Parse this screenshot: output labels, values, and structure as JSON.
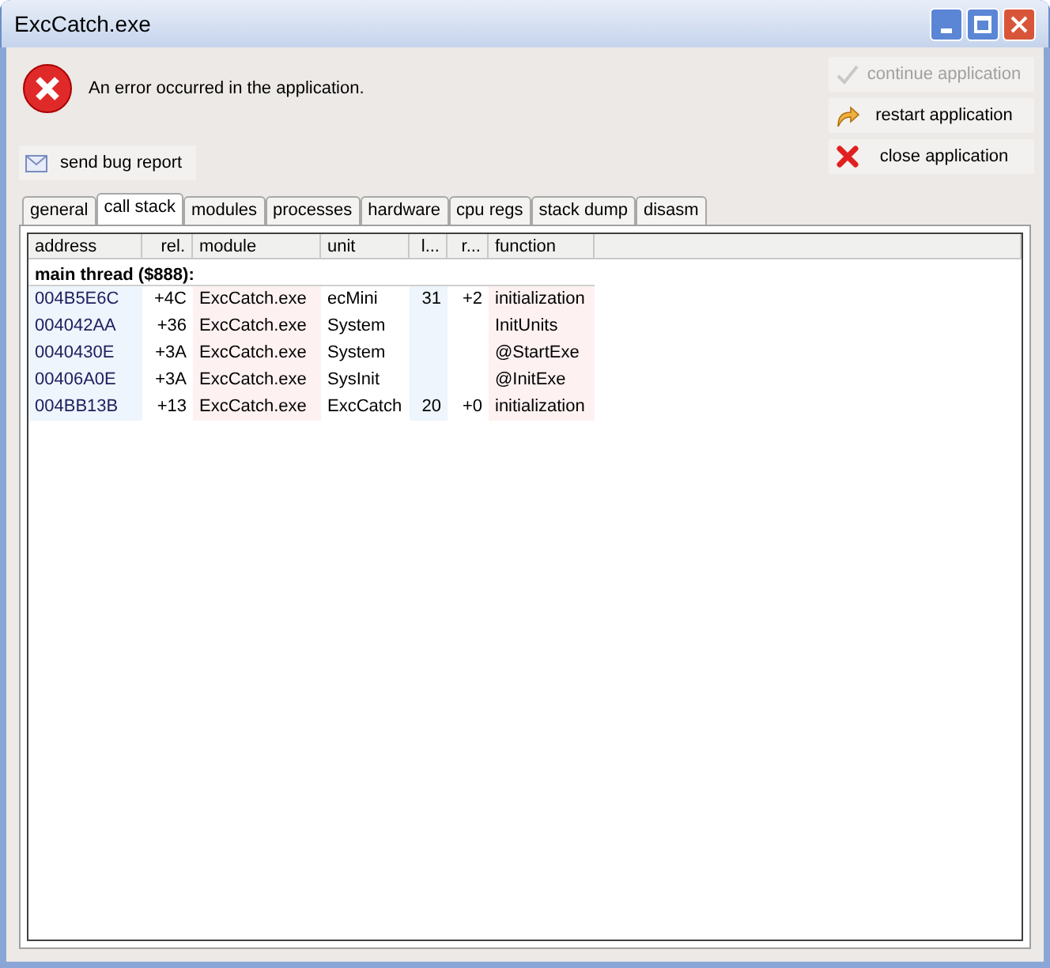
{
  "window": {
    "title": "ExcCatch.exe"
  },
  "message": "An error occurred in the application.",
  "report_button": {
    "label": "send bug report"
  },
  "actions": [
    {
      "kind": "continue",
      "label": "continue application",
      "disabled": true
    },
    {
      "kind": "restart",
      "label": "restart application",
      "disabled": false
    },
    {
      "kind": "close",
      "label": "close application",
      "disabled": false
    }
  ],
  "tabs": [
    {
      "label": "general",
      "selected": false
    },
    {
      "label": "call stack",
      "selected": true
    },
    {
      "label": "modules",
      "selected": false
    },
    {
      "label": "processes",
      "selected": false
    },
    {
      "label": "hardware",
      "selected": false
    },
    {
      "label": "cpu regs",
      "selected": false
    },
    {
      "label": "stack dump",
      "selected": false
    },
    {
      "label": "disasm",
      "selected": false
    }
  ],
  "table": {
    "columns": [
      "address",
      "rel.",
      "module",
      "unit",
      "l...",
      "r...",
      "function"
    ],
    "group": "main thread ($888):",
    "rows": [
      [
        "004B5E6C",
        "+4C",
        "ExcCatch.exe",
        "ecMini",
        "31",
        "+2",
        "initialization"
      ],
      [
        "004042AA",
        "+36",
        "ExcCatch.exe",
        "System",
        "",
        "",
        "InitUnits"
      ],
      [
        "0040430E",
        "+3A",
        "ExcCatch.exe",
        "System",
        "",
        "",
        "@StartExe"
      ],
      [
        "00406A0E",
        "+3A",
        "ExcCatch.exe",
        "SysInit",
        "",
        "",
        "@InitExe"
      ],
      [
        "004BB13B",
        "+13",
        "ExcCatch.exe",
        "ExcCatch",
        "20",
        "+0",
        "initialization"
      ]
    ]
  }
}
